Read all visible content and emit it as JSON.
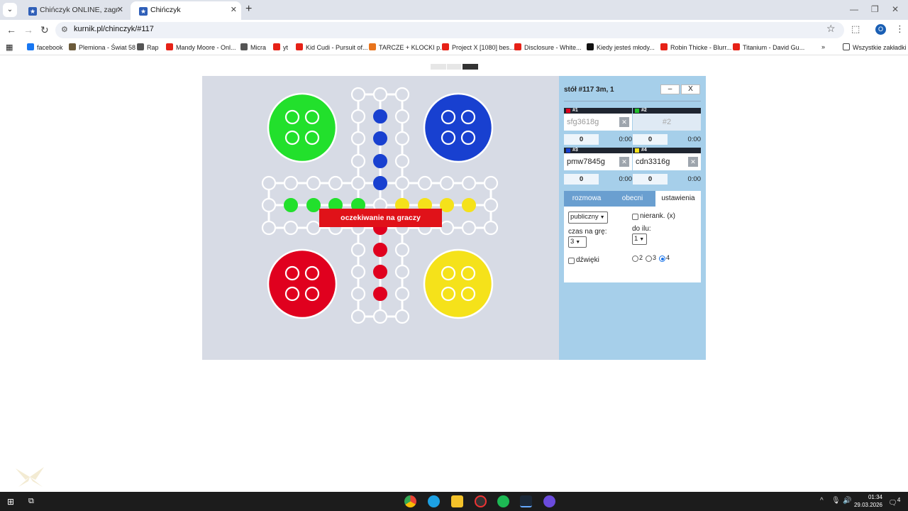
{
  "browser": {
    "tabs": [
      {
        "title": "Chińczyk ONLINE, zagraj - Kurn",
        "active": false
      },
      {
        "title": "Chińczyk",
        "active": true
      }
    ],
    "url": "kurnik.pl/chinczyk/#117",
    "bookmarks": [
      {
        "label": "facebook",
        "color": "#1877f2"
      },
      {
        "label": "Plemiona - Świat 58",
        "color": "#6b5a3a"
      },
      {
        "label": "Rap",
        "color": "#555555"
      },
      {
        "label": "Mandy Moore - Onl...",
        "color": "#e62117"
      },
      {
        "label": "Micra",
        "color": "#555555"
      },
      {
        "label": "yt",
        "color": "#e62117"
      },
      {
        "label": "Kid Cudi - Pursuit of...",
        "color": "#e62117"
      },
      {
        "label": "TARCZE + KLOCKI p...",
        "color": "#e8741c"
      },
      {
        "label": "Project X [1080] bes...",
        "color": "#e62117"
      },
      {
        "label": "Disclosure - White...",
        "color": "#e62117"
      },
      {
        "label": "Kiedy jesteś młody...",
        "color": "#111111"
      },
      {
        "label": "Robin Thicke - Blurr...",
        "color": "#e62117"
      },
      {
        "label": "Titanium - David Gu...",
        "color": "#e62117"
      }
    ],
    "all_bookmarks": "Wszystkie zakładki",
    "profile_initial": "O"
  },
  "game": {
    "status": "oczekiwanie na graczy",
    "colors": {
      "green": "#22e02c",
      "blue": "#1840d0",
      "red": "#e0001e",
      "yellow": "#f5e21a"
    }
  },
  "panel": {
    "table_title": "stół #117   3m, 1",
    "minimize": "–",
    "close": "X",
    "players": [
      {
        "slot": "#1",
        "color": "#e0001e",
        "name": "sfg3618g",
        "score": "0",
        "time": "0:00",
        "state": "gray"
      },
      {
        "slot": "#2",
        "color": "#22c02c",
        "name": "#2",
        "score": "0",
        "time": "0:00",
        "state": "empty"
      },
      {
        "slot": "#3",
        "color": "#1840d0",
        "name": "pmw7845g",
        "score": "0",
        "time": "0:00",
        "state": "normal"
      },
      {
        "slot": "#4",
        "color": "#f5e21a",
        "name": "cdn3316g",
        "score": "0",
        "time": "0:00",
        "state": "normal"
      }
    ],
    "tabs": [
      "rozmowa",
      "obecni",
      "ustawienia"
    ],
    "settings": {
      "visibility": "publiczny",
      "unranked": "nierank. (x)",
      "time_label": "czas na grę:",
      "time_value": "3",
      "up_to_label": "do ilu:",
      "up_to_value": "1",
      "sounds": "dźwięki",
      "players_options": [
        "2",
        "3",
        "4"
      ]
    }
  },
  "taskbar": {
    "time": "01:34",
    "date": "29.03.2026",
    "notifications": "4"
  }
}
